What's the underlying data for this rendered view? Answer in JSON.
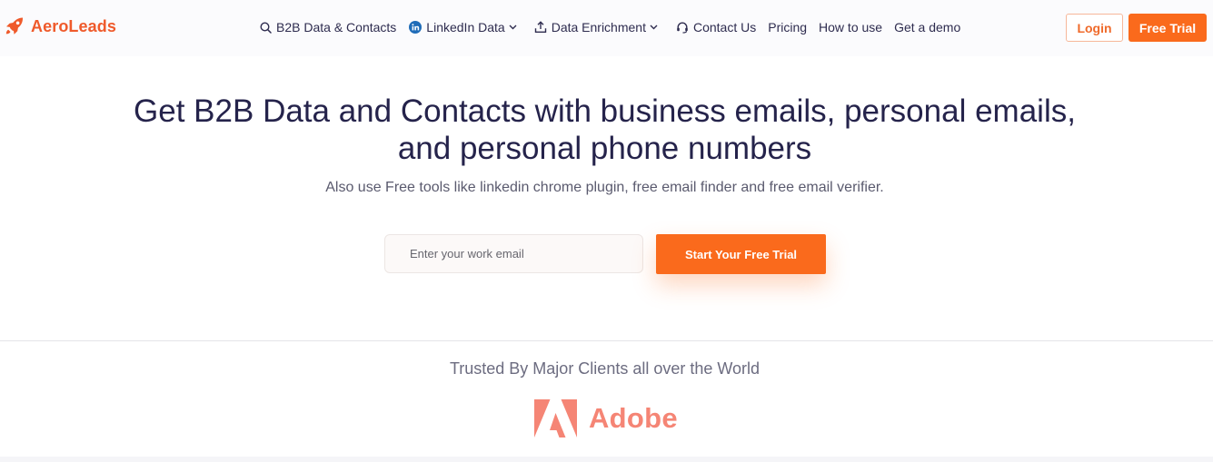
{
  "brand": {
    "name": "AeroLeads",
    "accent": "#fa6a1c",
    "logo_color": "#ef5a2b"
  },
  "nav": {
    "items": [
      {
        "label": "B2B Data & Contacts",
        "icon": "search-icon",
        "dropdown": false
      },
      {
        "label": "LinkedIn Data",
        "icon": "linkedin-icon",
        "dropdown": true
      },
      {
        "label": "Data Enrichment",
        "icon": "upload-icon",
        "dropdown": true
      },
      {
        "label": "Contact Us",
        "icon": "headset-icon",
        "dropdown": false
      },
      {
        "label": "Pricing",
        "icon": "",
        "dropdown": false
      },
      {
        "label": "How to use",
        "icon": "",
        "dropdown": false
      },
      {
        "label": "Get a demo",
        "icon": "",
        "dropdown": false
      }
    ],
    "login_label": "Login",
    "free_trial_label": "Free Trial"
  },
  "hero": {
    "headline_line1": "Get B2B Data and Contacts with business emails, personal emails,",
    "headline_line2": "and personal phone numbers",
    "subheadline": "Also use Free tools like linkedin chrome plugin, free email finder and free email verifier.",
    "email_placeholder": "Enter your work email",
    "email_value": "",
    "cta_label": "Start Your Free Trial"
  },
  "clients": {
    "heading": "Trusted By Major Clients all over the World",
    "logo_text": "Adobe",
    "logo_color": "#f58575"
  }
}
